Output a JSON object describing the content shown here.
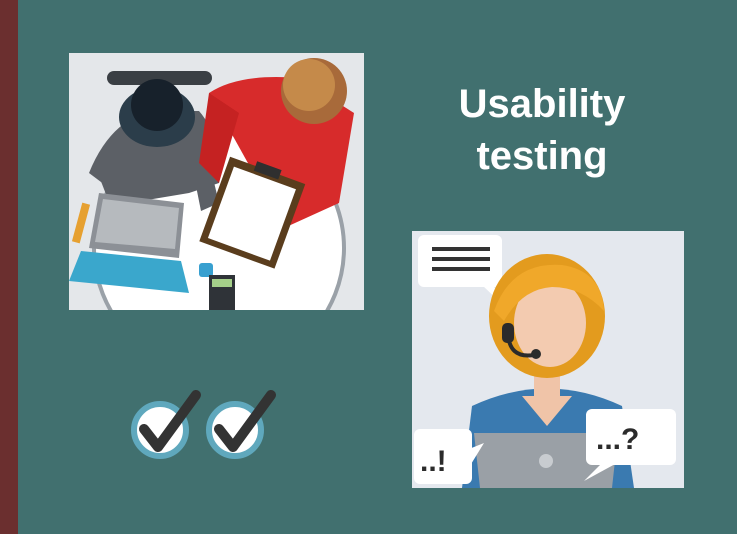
{
  "title": {
    "line1": "Usability",
    "line2": "testing"
  },
  "illustrations": {
    "top_left": "two-people-at-desk-illustration",
    "bottom_right": "support-agent-headset-illustration"
  },
  "bubbles": {
    "left_mark": "..!",
    "right_mark": "...?"
  },
  "checkmark_count": 2,
  "colors": {
    "frame": "#6b2f2f",
    "background": "#41706f",
    "title_text": "#ffffff",
    "check_ring": "#5fa8bd",
    "check_mark": "#333333"
  }
}
